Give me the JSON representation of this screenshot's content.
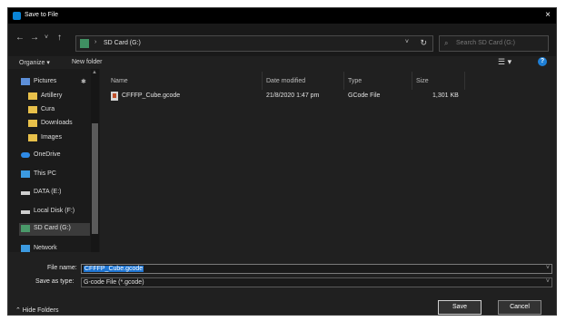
{
  "window": {
    "title": "Save to File",
    "close": "×"
  },
  "nav": {
    "back": "←",
    "forward": "→",
    "recent": "˅",
    "up": "↑",
    "sep": "›",
    "path": "SD Card (G:)",
    "dropdown": "˅",
    "refresh": "↻",
    "search_placeholder": "Search SD Card (G:)"
  },
  "toolbar": {
    "organize": "Organize ▾",
    "new_folder": "New folder",
    "view": "☰ ▾",
    "help": "?"
  },
  "sidebar": {
    "pin": "✱",
    "items": [
      {
        "label": "Pictures",
        "icon": "pictures-icon",
        "color": "#5d8fd8"
      },
      {
        "label": "Artillery",
        "icon": "folder-icon",
        "color": "#e8c04a"
      },
      {
        "label": "Cura",
        "icon": "folder-icon",
        "color": "#e8c04a"
      },
      {
        "label": "Downloads",
        "icon": "folder-icon",
        "color": "#e8c04a"
      },
      {
        "label": "Images",
        "icon": "folder-icon",
        "color": "#e8c04a"
      },
      {
        "label": "OneDrive",
        "icon": "cloud-icon",
        "color": "#2e8ae6"
      },
      {
        "label": "This PC",
        "icon": "pc-icon",
        "color": "#3c9ae0"
      },
      {
        "label": "DATA (E:)",
        "icon": "drive-icon",
        "color": "#cfcfcf"
      },
      {
        "label": "Local Disk (F:)",
        "icon": "drive-icon",
        "color": "#cfcfcf"
      },
      {
        "label": "SD Card (G:)",
        "icon": "sdcard-icon",
        "color": "#4a9a6a"
      },
      {
        "label": "Network",
        "icon": "network-icon",
        "color": "#3c9ae0"
      }
    ]
  },
  "columns": {
    "name": "Name",
    "date": "Date modified",
    "type": "Type",
    "size": "Size"
  },
  "files": [
    {
      "name": "CFFFP_Cube.gcode",
      "date": "21/8/2020 1:47 pm",
      "type": "GCode File",
      "size": "1,301 KB"
    }
  ],
  "footer": {
    "file_name_label": "File name:",
    "file_name_value": "CFFFP_Cube.gcode",
    "save_as_label": "Save as type:",
    "save_as_value": "G-code File (*.gcode)",
    "dropdown": "˅",
    "hide_folders": "⌃  Hide Folders",
    "save": "Save",
    "cancel": "Cancel"
  }
}
